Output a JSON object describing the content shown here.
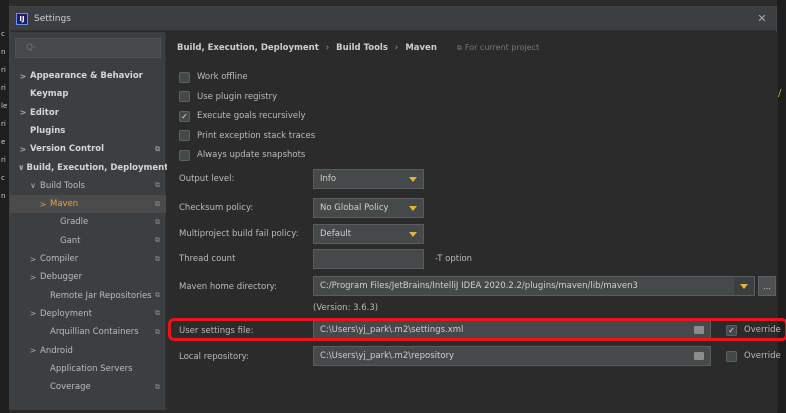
{
  "window": {
    "title": "Settings",
    "app_icon": "IJ"
  },
  "left_strip": [
    "c",
    "n",
    "ri",
    "ri",
    "le",
    "ri",
    "e",
    "ri",
    "c",
    "n"
  ],
  "right_strip": "/",
  "search": {
    "placeholder": "Q-"
  },
  "tree": [
    {
      "label": "Appearance & Behavior",
      "chevron": ">",
      "bold": true,
      "tag": ""
    },
    {
      "label": "Keymap",
      "chevron": "",
      "bold": true,
      "tag": ""
    },
    {
      "label": "Editor",
      "chevron": ">",
      "bold": true,
      "tag": ""
    },
    {
      "label": "Plugins",
      "chevron": "",
      "bold": true,
      "tag": ""
    },
    {
      "label": "Version Control",
      "chevron": ">",
      "bold": true,
      "tag": "⧉"
    },
    {
      "label": "Build, Execution, Deployment",
      "chevron": "∨",
      "bold": true,
      "tag": ""
    },
    {
      "label": "Build Tools",
      "chevron": "∨",
      "bold": false,
      "tag": "⧉"
    },
    {
      "label": "Maven",
      "chevron": ">",
      "bold": false,
      "tag": "⧉",
      "selected": true
    },
    {
      "label": "Gradle",
      "chevron": "",
      "bold": false,
      "tag": "⧉"
    },
    {
      "label": "Gant",
      "chevron": "",
      "bold": false,
      "tag": "⧉"
    },
    {
      "label": "Compiler",
      "chevron": ">",
      "bold": false,
      "tag": "⧉"
    },
    {
      "label": "Debugger",
      "chevron": ">",
      "bold": false,
      "tag": ""
    },
    {
      "label": "Remote Jar Repositories",
      "chevron": "",
      "bold": false,
      "tag": "⧉"
    },
    {
      "label": "Deployment",
      "chevron": ">",
      "bold": false,
      "tag": "⧉"
    },
    {
      "label": "Arquillian Containers",
      "chevron": "",
      "bold": false,
      "tag": "⧉"
    },
    {
      "label": "Android",
      "chevron": ">",
      "bold": false,
      "tag": ""
    },
    {
      "label": "Application Servers",
      "chevron": "",
      "bold": false,
      "tag": ""
    },
    {
      "label": "Coverage",
      "chevron": "",
      "bold": false,
      "tag": "⧉"
    }
  ],
  "breadcrumb": {
    "items": [
      "Build, Execution, Deployment",
      "Build Tools",
      "Maven"
    ],
    "separator": "›",
    "note": "For current project",
    "note_icon": "⧉"
  },
  "checkboxes": [
    {
      "label": "Work offline",
      "checked": false
    },
    {
      "label": "Use plugin registry",
      "checked": false
    },
    {
      "label": "Execute goals recursively",
      "checked": true
    },
    {
      "label": "Print exception stack traces",
      "checked": false
    },
    {
      "label": "Always update snapshots",
      "checked": false
    }
  ],
  "fields": {
    "output_level": {
      "label": "Output level:",
      "value": "Info"
    },
    "checksum_policy": {
      "label": "Checksum policy:",
      "value": "No Global Policy"
    },
    "multiproject_fail": {
      "label": "Multiproject build fail policy:",
      "value": "Default"
    },
    "thread_count": {
      "label": "Thread count",
      "value": "",
      "hint": "-T option"
    },
    "maven_home": {
      "label": "Maven home directory:",
      "value": "C:/Program Files/JetBrains/IntelliJ IDEA 2020.2.2/plugins/maven/lib/maven3",
      "browse": "..."
    },
    "version": "(Version: 3.6.3)",
    "user_settings": {
      "label": "User settings file:",
      "value": "C:\\Users\\yj_park\\.m2\\settings.xml",
      "override_label": "Override",
      "override": true
    },
    "local_repo": {
      "label": "Local repository:",
      "value": "C:\\Users\\yj_park\\.m2\\repository",
      "override_label": "Override",
      "override": false
    }
  },
  "colors": {
    "highlight": "#e8131b",
    "accent": "#e8a33d"
  }
}
